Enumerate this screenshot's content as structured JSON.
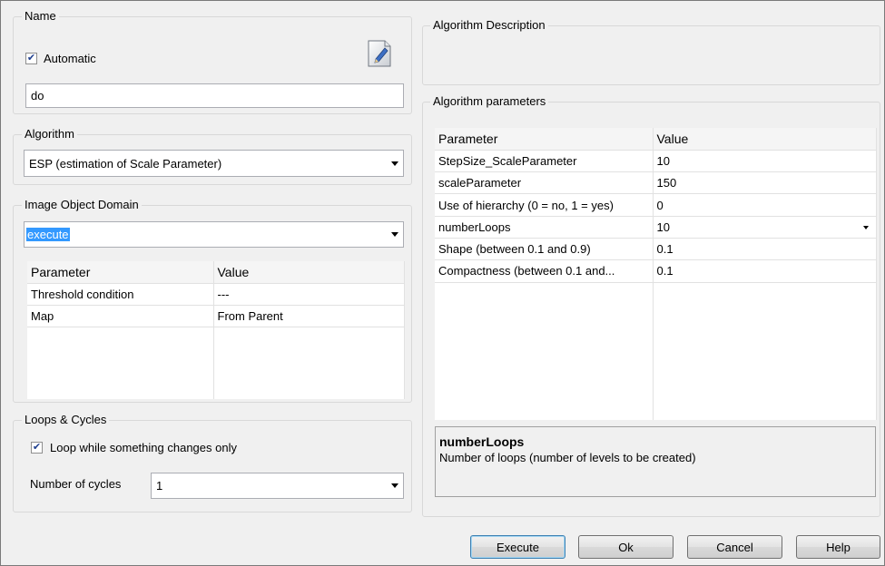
{
  "name_group": {
    "title": "Name",
    "automatic_label": "Automatic",
    "automatic_checked": true,
    "name_value": "do",
    "icon": "document-edit-icon"
  },
  "algorithm_group": {
    "title": "Algorithm",
    "selected": "ESP (estimation of Scale Parameter)"
  },
  "domain_group": {
    "title": "Image Object Domain",
    "selected": "execute",
    "headers": [
      "Parameter",
      "Value"
    ],
    "rows": [
      [
        "Threshold condition",
        "---"
      ],
      [
        "Map",
        "From Parent"
      ]
    ]
  },
  "loops_group": {
    "title": "Loops & Cycles",
    "loop_label": "Loop while something changes only",
    "loop_checked": true,
    "cycles_label": "Number of cycles",
    "cycles_value": "1"
  },
  "description_group": {
    "title": "Algorithm Description"
  },
  "params_group": {
    "title": "Algorithm parameters",
    "headers": [
      "Parameter",
      "Value"
    ],
    "rows": [
      [
        "StepSize_ScaleParameter",
        "10"
      ],
      [
        "scaleParameter",
        "150"
      ],
      [
        "Use of hierarchy (0 = no, 1 = yes)",
        "0"
      ],
      [
        "numberLoops",
        "10"
      ],
      [
        "Shape (between 0.1 and 0.9)",
        "0.1"
      ],
      [
        "Compactness (between 0.1 and...",
        "0.1"
      ]
    ],
    "help_title": "numberLoops",
    "help_text": "Number of loops (number of levels to be created)"
  },
  "buttons": {
    "execute": "Execute",
    "ok": "Ok",
    "cancel": "Cancel",
    "help": "Help"
  }
}
